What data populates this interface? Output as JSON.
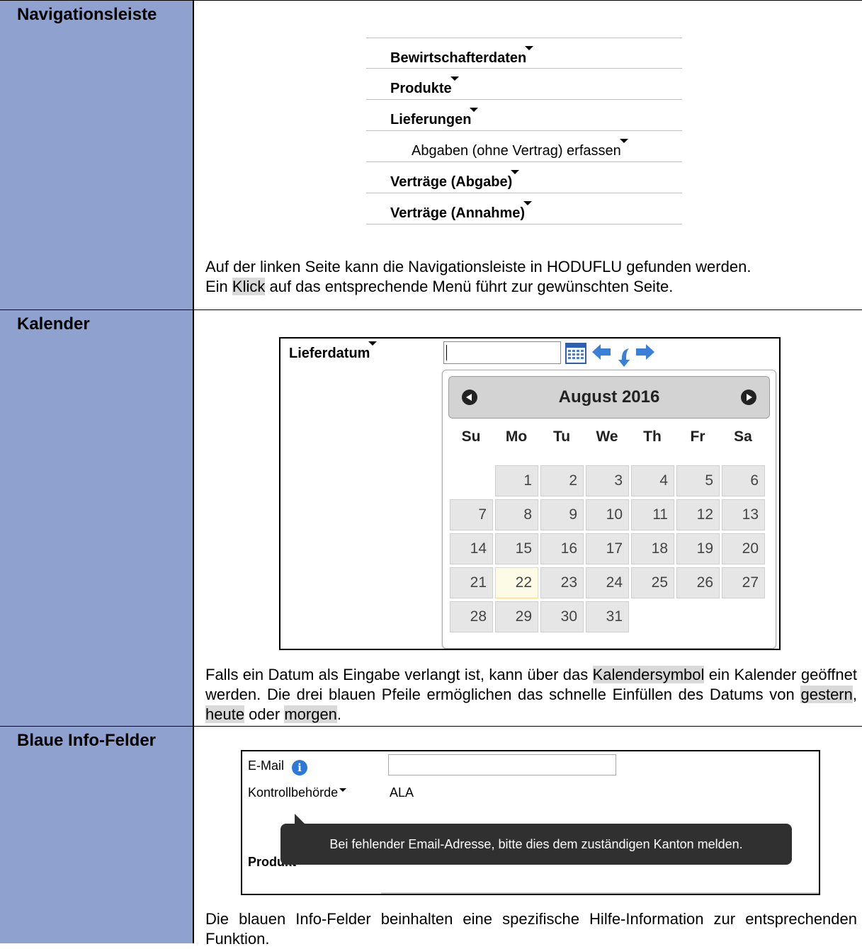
{
  "rows": [
    {
      "label": "Navigationsleiste",
      "nav_items": [
        {
          "label": "Bewirtschafterdaten"
        },
        {
          "label": "Produkte"
        },
        {
          "label": "Lieferungen"
        },
        {
          "label": "Abgaben (ohne Vertrag) erfassen"
        },
        {
          "label": "Verträge (Abgabe)"
        },
        {
          "label": "Verträge (Annahme)"
        }
      ],
      "desc_line1": "Auf der linken Seite kann die Navigationsleiste in HODUFLU gefunden werden.",
      "desc_line2_a": "Ein ",
      "desc_line2_hl": "Klick",
      "desc_line2_b": " auf das entsprechende Menü führt zur gewünschten Seite."
    },
    {
      "label": "Kalender",
      "field_label": "Lieferdatum",
      "month_title": "August 2016",
      "weekdays": [
        "Su",
        "Mo",
        "Tu",
        "We",
        "Th",
        "Fr",
        "Sa"
      ],
      "days": [
        "1",
        "2",
        "3",
        "4",
        "5",
        "6",
        "7",
        "8",
        "9",
        "10",
        "11",
        "12",
        "13",
        "14",
        "15",
        "16",
        "17",
        "18",
        "19",
        "20",
        "21",
        "22",
        "23",
        "24",
        "25",
        "26",
        "27",
        "28",
        "29",
        "30",
        "31"
      ],
      "today": "22",
      "desc_a": "Falls ein Datum als Eingabe verlangt ist, kann über das ",
      "desc_hl1": "Kalendersymbol",
      "desc_b": " ein Kalender geöffnet werden. Die drei blauen Pfeile ermöglichen das schnelle Einfüllen des Datums von ",
      "desc_hl2": "gestern",
      "desc_c": ", ",
      "desc_hl3": "heute",
      "desc_d": " oder ",
      "desc_hl4": "morgen",
      "desc_e": "."
    },
    {
      "label": "Blaue Info-Felder",
      "email_label": "E-Mail",
      "kontroll_label": "Kontrollbehörde",
      "kontroll_value": "ALA",
      "produkt_label": "Produkt",
      "tooltip": "Bei fehlender Email-Adresse, bitte dies dem zuständigen Kanton melden.",
      "desc": "Die blauen Info-Felder beinhalten eine spezifische Hilfe-Information zur entsprechenden Funktion."
    }
  ],
  "colors": {
    "label_bg": "#8ea1cf",
    "highlight": "#d9d9d9",
    "info_icon": "#2b78d8"
  },
  "icons": [
    "calendar-icon",
    "arrow-left-icon",
    "arrow-down-icon",
    "arrow-right-icon",
    "info-icon"
  ]
}
